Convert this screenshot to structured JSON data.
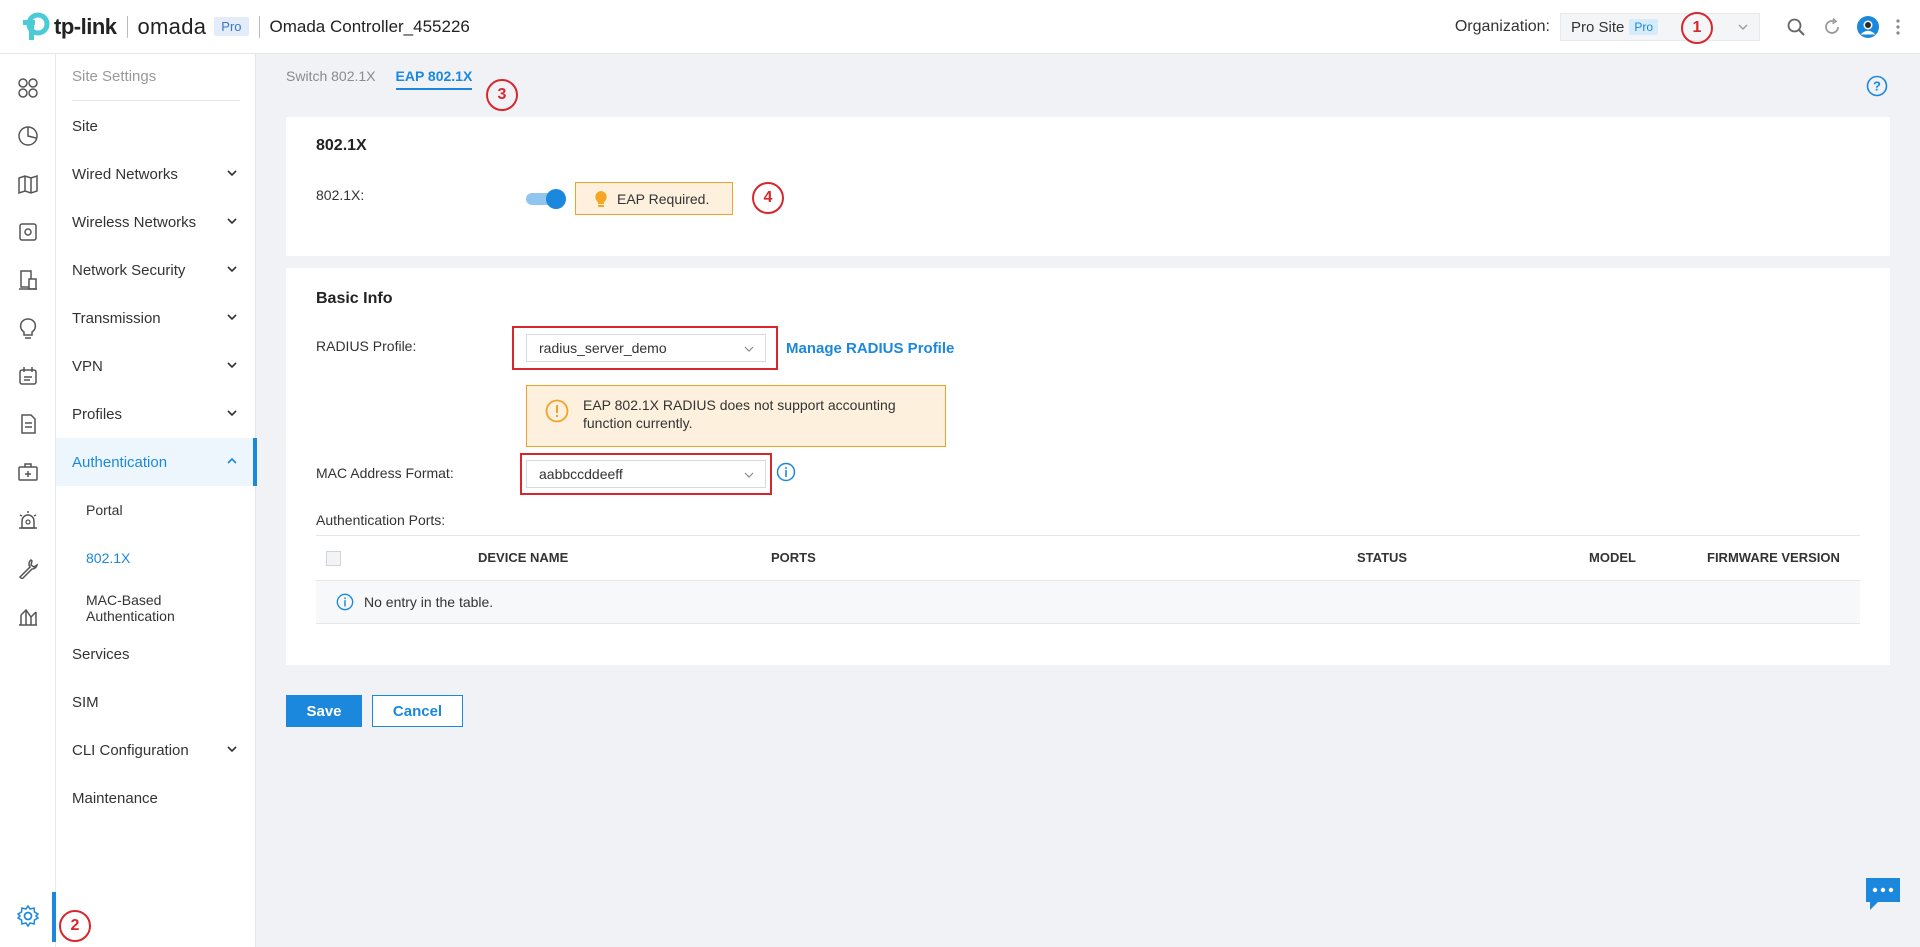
{
  "brand": {
    "tp": "tp-link",
    "omada": "omada",
    "pro": "Pro",
    "controller": "Omada Controller_455226"
  },
  "header": {
    "org_label": "Organization:",
    "org_value": "Pro Site",
    "org_badge": "Pro",
    "icons": [
      "search-icon",
      "refresh-icon",
      "user-avatar-icon",
      "more-icon"
    ]
  },
  "annotations": {
    "a1": "1",
    "a2": "2",
    "a3": "3",
    "a4": "4"
  },
  "rail_icons": [
    "dashboard-icon",
    "statistics-icon",
    "map-icon",
    "devices-icon",
    "clients-icon",
    "insights-icon",
    "logs-icon",
    "report-icon",
    "toolbox-icon",
    "alerts-icon",
    "tools-icon",
    "analytics-icon",
    "settings-icon"
  ],
  "sidebar": {
    "header": "Site Settings",
    "items": [
      {
        "label": "Site",
        "chevron": false
      },
      {
        "label": "Wired Networks",
        "chevron": true
      },
      {
        "label": "Wireless Networks",
        "chevron": true
      },
      {
        "label": "Network Security",
        "chevron": true
      },
      {
        "label": "Transmission",
        "chevron": true
      },
      {
        "label": "VPN",
        "chevron": true
      },
      {
        "label": "Profiles",
        "chevron": true
      },
      {
        "label": "Authentication",
        "chevron": true,
        "active": true
      },
      {
        "label": "Services",
        "chevron": false
      },
      {
        "label": "SIM",
        "chevron": false
      },
      {
        "label": "CLI Configuration",
        "chevron": true
      },
      {
        "label": "Maintenance",
        "chevron": false
      }
    ],
    "sub_items": [
      {
        "label": "Portal"
      },
      {
        "label": "802.1X",
        "active": true
      },
      {
        "label": "MAC-Based Authentication"
      }
    ]
  },
  "tabs": [
    {
      "label": "Switch 802.1X",
      "active": false
    },
    {
      "label": "EAP 802.1X",
      "active": true
    }
  ],
  "section_8021x": {
    "title": "802.1X",
    "field_label": "802.1X:",
    "toggle_on": true,
    "tip": "EAP Required."
  },
  "basic_info": {
    "title": "Basic Info",
    "radius_label": "RADIUS Profile:",
    "radius_value": "radius_server_demo",
    "manage_link": "Manage RADIUS Profile",
    "warning": "EAP 802.1X RADIUS does not support accounting function currently.",
    "mac_label": "MAC Address Format:",
    "mac_value": "aabbccddeeff",
    "ports_label": "Authentication Ports:"
  },
  "table": {
    "columns": [
      "DEVICE NAME",
      "PORTS",
      "STATUS",
      "MODEL",
      "FIRMWARE VERSION"
    ],
    "empty": "No entry in the table."
  },
  "buttons": {
    "save": "Save",
    "cancel": "Cancel"
  },
  "colors": {
    "accent": "#1b88dd",
    "warning_border": "#f2a12c",
    "annotation": "#d8262d"
  }
}
